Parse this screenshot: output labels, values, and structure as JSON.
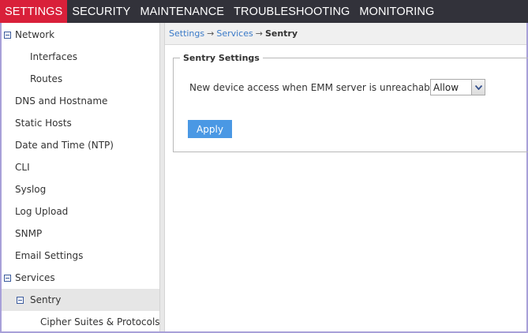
{
  "topnav": {
    "tabs": [
      {
        "label": "SETTINGS",
        "active": true
      },
      {
        "label": "SECURITY",
        "active": false
      },
      {
        "label": "MAINTENANCE",
        "active": false
      },
      {
        "label": "TROUBLESHOOTING",
        "active": false
      },
      {
        "label": "MONITORING",
        "active": false
      }
    ]
  },
  "sidebar": {
    "items": [
      {
        "label": "Network",
        "expanded": true
      },
      {
        "label": "Interfaces"
      },
      {
        "label": "Routes"
      },
      {
        "label": "DNS and Hostname"
      },
      {
        "label": "Static Hosts"
      },
      {
        "label": "Date and Time (NTP)"
      },
      {
        "label": "CLI"
      },
      {
        "label": "Syslog"
      },
      {
        "label": "Log Upload"
      },
      {
        "label": "SNMP"
      },
      {
        "label": "Email Settings"
      },
      {
        "label": "Services",
        "expanded": true
      },
      {
        "label": "Sentry",
        "expanded": true,
        "selected": true
      },
      {
        "label": "Cipher Suites & Protocols"
      }
    ]
  },
  "breadcrumb": {
    "items": [
      "Settings",
      "Services"
    ],
    "separator": "→",
    "current": "Sentry"
  },
  "form": {
    "legend": "Sentry Settings",
    "label": "New device access when EMM server is unreachable :",
    "select_value": "Allow",
    "apply_label": "Apply"
  },
  "colors": {
    "accent": "#d9203a",
    "topbar": "#32323a",
    "link": "#3a7ac8",
    "button": "#4a98e4"
  }
}
